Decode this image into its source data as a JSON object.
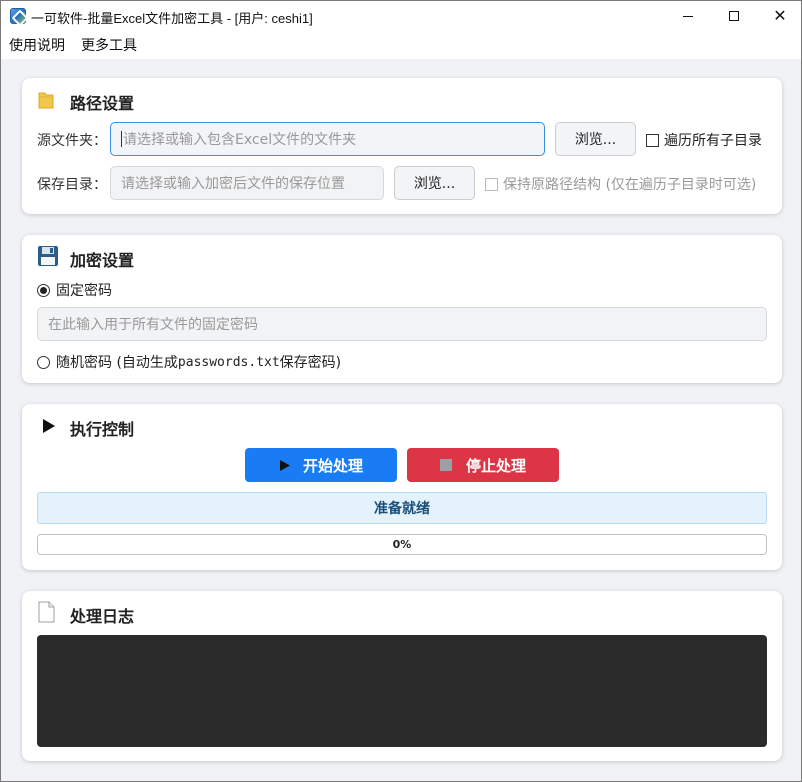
{
  "window": {
    "title": "一可软件-批量Excel文件加密工具 - [用户: ceshi1]"
  },
  "menu": {
    "items": [
      "使用说明",
      "更多工具"
    ]
  },
  "path_settings": {
    "title": "路径设置",
    "source_label": "源文件夹：",
    "source_placeholder": "请选择或输入包含Excel文件的文件夹",
    "source_browse": "浏览...",
    "recurse_label": "遍历所有子目录",
    "output_label": "保存目录：",
    "output_placeholder": "请选择或输入加密后文件的保存位置",
    "output_browse": "浏览...",
    "keep_structure_label": "保持原路径结构 (仅在遍历子目录时可选)"
  },
  "encrypt_settings": {
    "title": "加密设置",
    "fixed_label": "固定密码",
    "fixed_placeholder": "在此输入用于所有文件的固定密码",
    "random_label_prefix": "随机密码 (自动生成 ",
    "random_label_file": "passwords.txt",
    "random_label_suffix": " 保存密码)",
    "selected": "fixed"
  },
  "exec_control": {
    "title": "执行控制",
    "start_label": "开始处理",
    "stop_label": "停止处理",
    "status_text": "准备就绪",
    "progress_text": "0%",
    "progress_value": 0
  },
  "log": {
    "title": "处理日志",
    "content": ""
  },
  "colors": {
    "start_button": "#1a7cf5",
    "stop_button": "#dc3545",
    "status_bg": "#e3f2fd",
    "status_text": "#1a4f7a",
    "log_bg": "#2b2b2b"
  }
}
